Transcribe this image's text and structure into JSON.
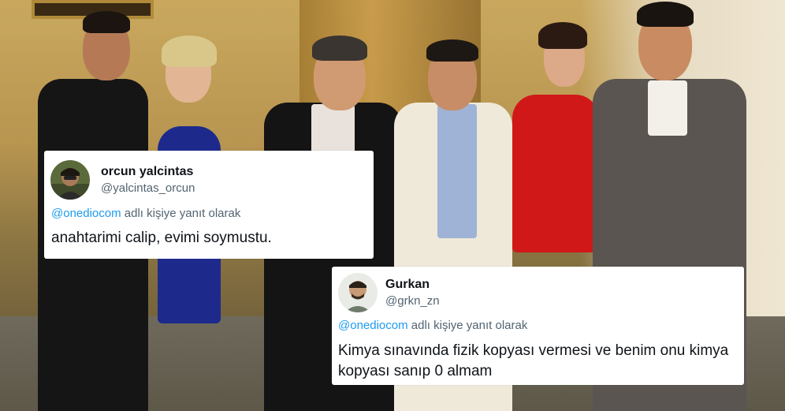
{
  "tweets": [
    {
      "name": "orcun yalcintas",
      "handle": "@yalcintas_orcun",
      "reply_mention": "@onediocom",
      "reply_suffix": " adlı kişiye yanıt olarak",
      "text": "anahtarimi calip, evimi soymustu."
    },
    {
      "name": "Gurkan",
      "handle": "@grkn_zn",
      "reply_mention": "@onediocom",
      "reply_suffix": " adlı kişiye yanıt olarak",
      "text": "Kimya sınavında fizik kopyası vermesi ve benim onu kimya kopyası sanıp 0 almam"
    }
  ],
  "colors": {
    "mention": "#1d9bf0",
    "secondary_text": "#536471",
    "primary_text": "#0f1419"
  }
}
